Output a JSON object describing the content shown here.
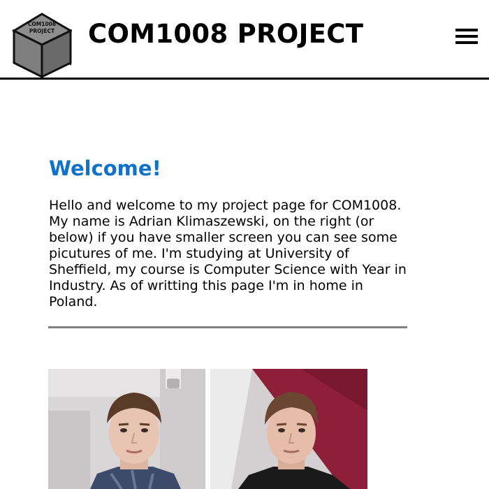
{
  "header": {
    "logo_text_line1": "COM1008",
    "logo_text_line2": "PROJECT",
    "title": "COM1008 PROJECT",
    "menu_icon": "hamburger-menu-icon"
  },
  "main": {
    "heading": "Welcome!",
    "intro": "Hello and welcome to my project page for COM1008. My name is Adrian Klimaszewski, on the right (or below) if you have smaller screen you can see some picutures of me. I'm studying at University of Sheffield, my course is Computer Science with Year in Industry. As of writting this page I'm in home in Poland."
  },
  "colors": {
    "heading": "#0f72c9",
    "divider": "#808080",
    "header_border": "#000000"
  }
}
